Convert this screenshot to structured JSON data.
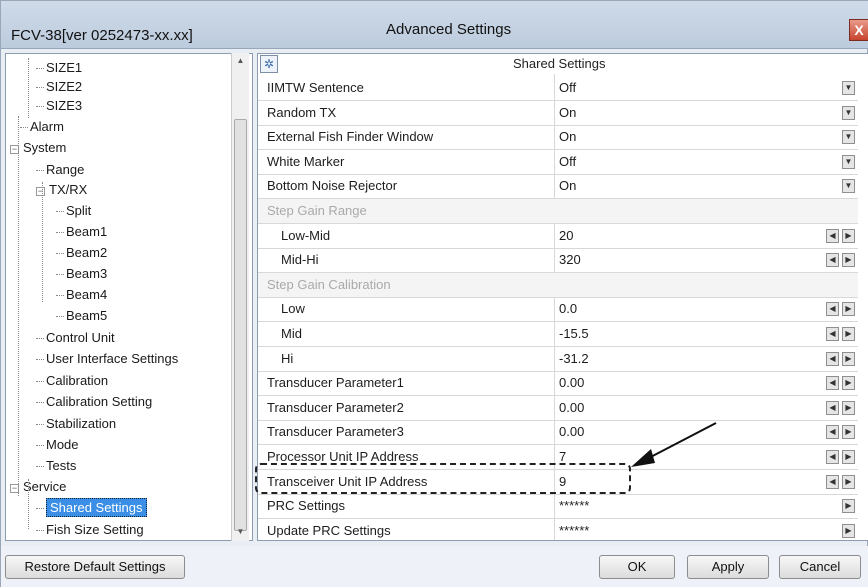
{
  "window": {
    "left_title": "FCV-38[ver 0252473-xx.xx]",
    "center_title": "Advanced Settings",
    "close_symbol": "X"
  },
  "tree": {
    "items": [
      {
        "label": "SIZE1"
      },
      {
        "label": "SIZE2"
      },
      {
        "label": "SIZE3"
      },
      {
        "label": "Alarm"
      },
      {
        "label": "System"
      },
      {
        "label": "Range"
      },
      {
        "label": "TX/RX"
      },
      {
        "label": "Split"
      },
      {
        "label": "Beam1"
      },
      {
        "label": "Beam2"
      },
      {
        "label": "Beam3"
      },
      {
        "label": "Beam4"
      },
      {
        "label": "Beam5"
      },
      {
        "label": "Control Unit"
      },
      {
        "label": "User Interface Settings"
      },
      {
        "label": "Calibration"
      },
      {
        "label": "Calibration Setting"
      },
      {
        "label": "Stabilization"
      },
      {
        "label": "Mode"
      },
      {
        "label": "Tests"
      },
      {
        "label": "Service"
      },
      {
        "label": "Shared Settings"
      },
      {
        "label": "Fish Size Setting"
      }
    ],
    "selected": "Shared Settings"
  },
  "grid": {
    "caption": "Shared Settings",
    "rows": [
      {
        "name": "IIMTW Sentence",
        "value": "Off",
        "control": "dropdown"
      },
      {
        "name": "Random TX",
        "value": "On",
        "control": "dropdown"
      },
      {
        "name": "External Fish Finder Window",
        "value": "On",
        "control": "dropdown"
      },
      {
        "name": "White Marker",
        "value": "Off",
        "control": "dropdown"
      },
      {
        "name": "Bottom Noise Rejector",
        "value": "On",
        "control": "dropdown"
      },
      {
        "name": "Step Gain Range",
        "value": "",
        "control": "category"
      },
      {
        "name": "Low-Mid",
        "value": "20",
        "control": "stepper"
      },
      {
        "name": "Mid-Hi",
        "value": "320",
        "control": "stepper"
      },
      {
        "name": "Step Gain Calibration",
        "value": "",
        "control": "category"
      },
      {
        "name": "Low",
        "value": "0.0",
        "control": "stepper"
      },
      {
        "name": "Mid",
        "value": "-15.5",
        "control": "stepper"
      },
      {
        "name": "Hi",
        "value": "-31.2",
        "control": "stepper"
      },
      {
        "name": "Transducer Parameter1",
        "value": "0.00",
        "control": "stepper"
      },
      {
        "name": "Transducer Parameter2",
        "value": "0.00",
        "control": "stepper"
      },
      {
        "name": "Transducer Parameter3",
        "value": "0.00",
        "control": "stepper"
      },
      {
        "name": "Processor Unit IP Address",
        "value": "7",
        "control": "stepper"
      },
      {
        "name": "Transceiver Unit IP Address",
        "value": "9",
        "control": "stepper"
      },
      {
        "name": "PRC Settings",
        "value": "******",
        "control": "open"
      },
      {
        "name": "Update PRC Settings",
        "value": "******",
        "control": "open"
      }
    ]
  },
  "buttons": {
    "restore": "Restore Default Settings",
    "ok": "OK",
    "apply": "Apply",
    "cancel": "Cancel"
  },
  "icons": {
    "expanded": "⊟",
    "sort": "grid-sort-icon"
  }
}
